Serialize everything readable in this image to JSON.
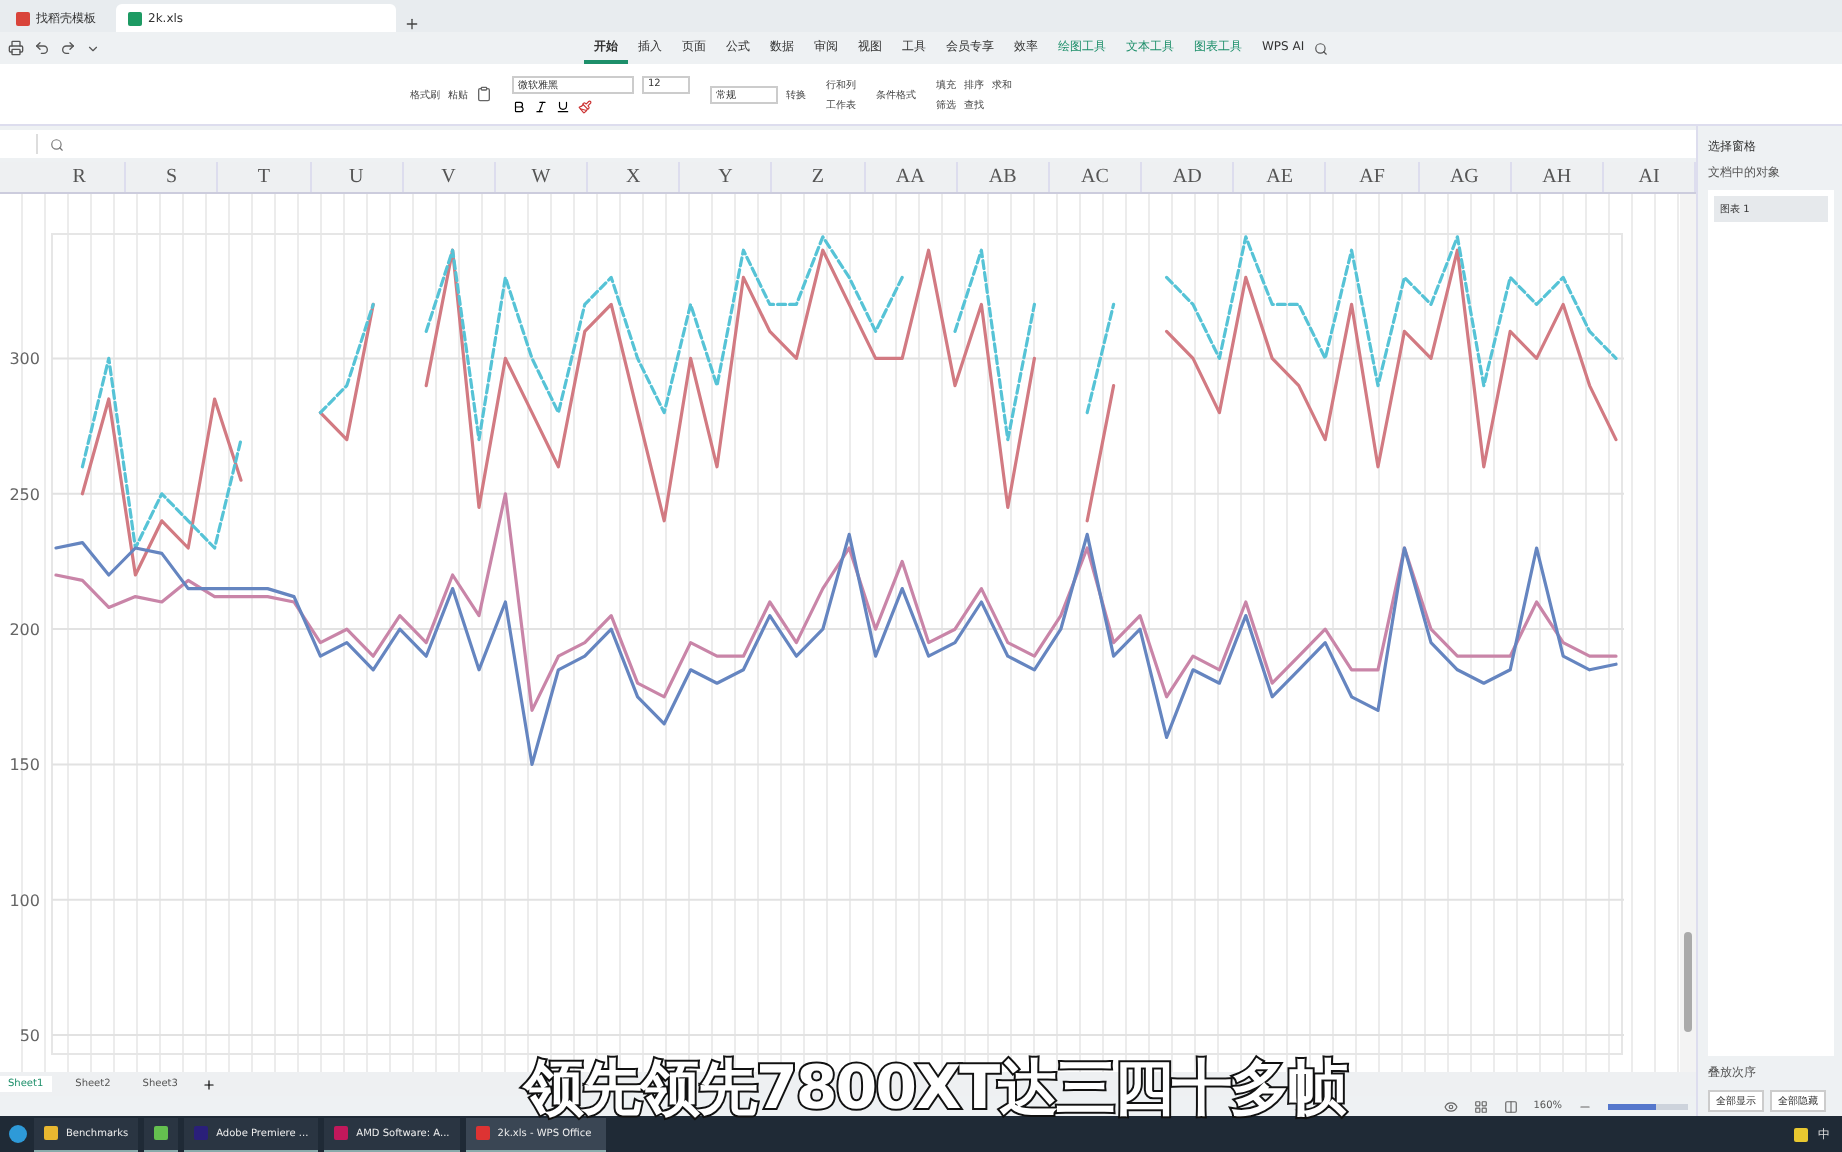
{
  "doc_tabs": [
    {
      "label": "找稻壳模板",
      "kind": "template",
      "selected": false
    },
    {
      "label": "2k.xls",
      "kind": "sheet",
      "selected": true
    }
  ],
  "menu_tabs": [
    {
      "label": "开始",
      "kind": "main",
      "selected": true
    },
    {
      "label": "插入",
      "kind": "main",
      "selected": false
    },
    {
      "label": "页面",
      "kind": "main",
      "selected": false
    },
    {
      "label": "公式",
      "kind": "main",
      "selected": false
    },
    {
      "label": "数据",
      "kind": "main",
      "selected": false
    },
    {
      "label": "审阅",
      "kind": "main",
      "selected": false
    },
    {
      "label": "视图",
      "kind": "main",
      "selected": false
    },
    {
      "label": "工具",
      "kind": "main",
      "selected": false
    },
    {
      "label": "会员专享",
      "kind": "main",
      "selected": false
    },
    {
      "label": "效率",
      "kind": "main",
      "selected": false
    },
    {
      "label": "绘图工具",
      "kind": "context",
      "selected": false
    },
    {
      "label": "文本工具",
      "kind": "context",
      "selected": false
    },
    {
      "label": "图表工具",
      "kind": "context",
      "selected": false
    },
    {
      "label": "WPS AI",
      "kind": "ai",
      "selected": false
    }
  ],
  "ribbon": {
    "format_painter": "格式刷",
    "paste": "粘贴",
    "font": "微软雅黑",
    "font_size": "12",
    "number_format": "常规",
    "convert": "转换",
    "rows_cols": "行和列",
    "worksheet": "工作表",
    "conditional": "条件格式",
    "fill": "填充",
    "sort": "排序",
    "sum": "求和",
    "filter": "筛选",
    "find": "查找"
  },
  "columns": [
    "R",
    "S",
    "T",
    "U",
    "V",
    "W",
    "X",
    "Y",
    "Z",
    "AA",
    "AB",
    "AC",
    "AD",
    "AE",
    "AF",
    "AG",
    "AH",
    "AI"
  ],
  "chart_data": {
    "type": "line",
    "grid": true,
    "ylim": [
      43,
      346
    ],
    "yticks": [
      50,
      100,
      150,
      200,
      250,
      300
    ],
    "series": [
      {
        "color": "#d27a82",
        "line_style": "solid",
        "values": [
          null,
          250,
          285,
          220,
          240,
          230,
          285,
          255,
          null,
          null,
          280,
          270,
          320,
          null,
          290,
          340,
          245,
          300,
          280,
          260,
          310,
          320,
          280,
          240,
          300,
          260,
          330,
          310,
          300,
          340,
          320,
          300,
          300,
          340,
          290,
          320,
          245,
          300,
          null,
          240,
          290,
          null,
          310,
          300,
          280,
          330,
          300,
          290,
          270,
          320,
          260,
          310,
          300,
          340,
          260,
          310,
          300,
          320,
          290,
          270
        ]
      },
      {
        "color": "#56c3d6",
        "line_style": "dashed",
        "values": [
          null,
          260,
          300,
          230,
          250,
          240,
          230,
          270,
          null,
          null,
          280,
          290,
          320,
          null,
          310,
          340,
          270,
          330,
          300,
          280,
          320,
          330,
          300,
          280,
          320,
          290,
          340,
          320,
          320,
          345,
          330,
          310,
          330,
          null,
          310,
          340,
          270,
          320,
          null,
          280,
          320,
          null,
          330,
          320,
          300,
          345,
          320,
          320,
          300,
          340,
          290,
          330,
          320,
          345,
          290,
          330,
          320,
          330,
          310,
          300
        ]
      },
      {
        "color": "#c985a8",
        "line_style": "solid",
        "values": [
          220,
          218,
          208,
          212,
          210,
          218,
          212,
          212,
          212,
          210,
          195,
          200,
          190,
          205,
          195,
          220,
          205,
          250,
          170,
          190,
          195,
          205,
          180,
          175,
          195,
          190,
          190,
          210,
          195,
          215,
          230,
          200,
          225,
          195,
          200,
          215,
          195,
          190,
          205,
          230,
          195,
          205,
          175,
          190,
          185,
          210,
          180,
          190,
          200,
          185,
          185,
          230,
          200,
          190,
          190,
          190,
          210,
          195,
          190,
          190
        ]
      },
      {
        "color": "#6585c0",
        "line_style": "solid",
        "values": [
          230,
          232,
          220,
          230,
          228,
          215,
          215,
          215,
          215,
          212,
          190,
          195,
          185,
          200,
          190,
          215,
          185,
          210,
          150,
          185,
          190,
          200,
          175,
          165,
          185,
          180,
          185,
          205,
          190,
          200,
          235,
          190,
          215,
          190,
          195,
          210,
          190,
          185,
          200,
          235,
          190,
          200,
          160,
          185,
          180,
          205,
          175,
          185,
          195,
          175,
          170,
          230,
          195,
          185,
          180,
          185,
          230,
          190,
          185,
          187
        ]
      }
    ]
  },
  "sheet_tabs": [
    {
      "label": "Sheet1",
      "selected": true
    },
    {
      "label": "Sheet2",
      "selected": false
    },
    {
      "label": "Sheet3",
      "selected": false
    }
  ],
  "status_bar": {
    "zoom": "160%",
    "level": 0.6
  },
  "selection_pane": {
    "title": "选择窗格",
    "subtitle": "文档中的对象",
    "items": [
      {
        "label": "图表 1",
        "selected": true
      }
    ],
    "order_label": "叠放次序",
    "buttons": [
      "全部显示",
      "全部隐藏"
    ]
  },
  "subtitle": "领先领先7800XT达三四十多帧",
  "taskbar": [
    {
      "label": "Benchmarks",
      "kind": "folder",
      "selected": false
    },
    {
      "kind": "app",
      "selected": false
    },
    {
      "label": "Adobe Premiere ...",
      "kind": "premiere",
      "selected": false
    },
    {
      "label": "AMD Software: A...",
      "kind": "amd",
      "selected": false
    },
    {
      "label": "2k.xls - WPS Office",
      "kind": "wps",
      "selected": true
    }
  ],
  "tray": {
    "ime": "中"
  }
}
